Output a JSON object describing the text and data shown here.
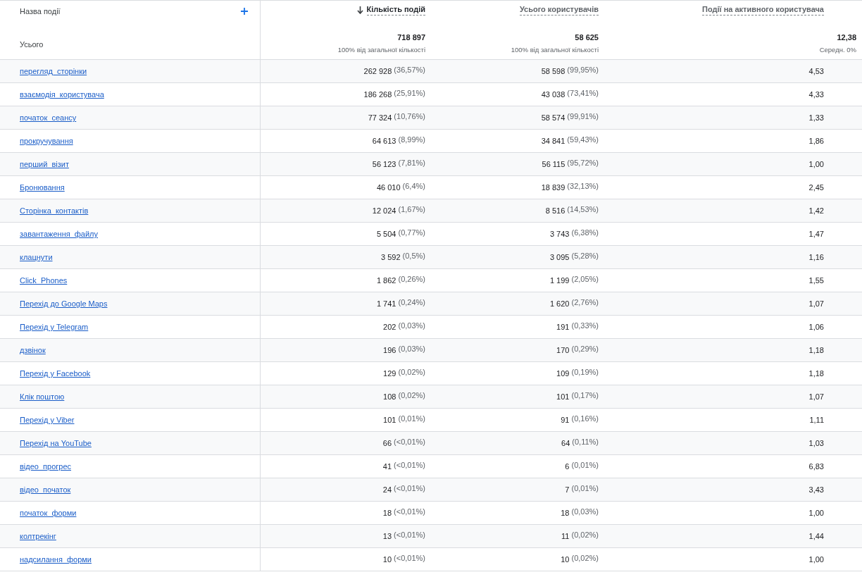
{
  "columns": [
    {
      "label": "Назва події",
      "kind": "dimension"
    },
    {
      "label": "Кількість подій",
      "kind": "metric",
      "sorted": true
    },
    {
      "label": "Усього користувачів",
      "kind": "metric",
      "sorted": false
    },
    {
      "label": "Події на активного користувача",
      "kind": "metric",
      "sorted": false
    }
  ],
  "totals": {
    "label": "Усього",
    "values": [
      {
        "value": "718 897",
        "note": "100% від загальної кількості"
      },
      {
        "value": "58 625",
        "note": "100% від загальної кількості"
      },
      {
        "value": "12,38",
        "note": "Середн. 0%"
      }
    ]
  },
  "rows": [
    {
      "name": "перегляд_сторінки",
      "events": "262 928",
      "events_pct": "(36,57%)",
      "users": "58 598",
      "users_pct": "(99,95%)",
      "per_user": "4,53"
    },
    {
      "name": "взаємодія_користувача",
      "events": "186 268",
      "events_pct": "(25,91%)",
      "users": "43 038",
      "users_pct": "(73,41%)",
      "per_user": "4,33"
    },
    {
      "name": "початок_сеансу",
      "events": "77 324",
      "events_pct": "(10,76%)",
      "users": "58 574",
      "users_pct": "(99,91%)",
      "per_user": "1,33"
    },
    {
      "name": "прокручування",
      "events": "64 613",
      "events_pct": "(8,99%)",
      "users": "34 841",
      "users_pct": "(59,43%)",
      "per_user": "1,86"
    },
    {
      "name": "перший_візит",
      "events": "56 123",
      "events_pct": "(7,81%)",
      "users": "56 115",
      "users_pct": "(95,72%)",
      "per_user": "1,00"
    },
    {
      "name": "Бронювання",
      "events": "46 010",
      "events_pct": "(6,4%)",
      "users": "18 839",
      "users_pct": "(32,13%)",
      "per_user": "2,45"
    },
    {
      "name": "Сторінка_контактів",
      "events": "12 024",
      "events_pct": "(1,67%)",
      "users": "8 516",
      "users_pct": "(14,53%)",
      "per_user": "1,42"
    },
    {
      "name": "завантаження_файлу",
      "events": "5 504",
      "events_pct": "(0,77%)",
      "users": "3 743",
      "users_pct": "(6,38%)",
      "per_user": "1,47"
    },
    {
      "name": "клацнути",
      "events": "3 592",
      "events_pct": "(0,5%)",
      "users": "3 095",
      "users_pct": "(5,28%)",
      "per_user": "1,16"
    },
    {
      "name": "Click_Phones",
      "events": "1 862",
      "events_pct": "(0,26%)",
      "users": "1 199",
      "users_pct": "(2,05%)",
      "per_user": "1,55"
    },
    {
      "name": "Перехід до Google Maps",
      "events": "1 741",
      "events_pct": "(0,24%)",
      "users": "1 620",
      "users_pct": "(2,76%)",
      "per_user": "1,07"
    },
    {
      "name": "Перехід у Telegram",
      "events": "202",
      "events_pct": "(0,03%)",
      "users": "191",
      "users_pct": "(0,33%)",
      "per_user": "1,06"
    },
    {
      "name": "дзвінок",
      "events": "196",
      "events_pct": "(0,03%)",
      "users": "170",
      "users_pct": "(0,29%)",
      "per_user": "1,18"
    },
    {
      "name": "Перехід у Facebook",
      "events": "129",
      "events_pct": "(0,02%)",
      "users": "109",
      "users_pct": "(0,19%)",
      "per_user": "1,18"
    },
    {
      "name": "Клік поштою",
      "events": "108",
      "events_pct": "(0,02%)",
      "users": "101",
      "users_pct": "(0,17%)",
      "per_user": "1,07"
    },
    {
      "name": "Перехід у Viber",
      "events": "101",
      "events_pct": "(0,01%)",
      "users": "91",
      "users_pct": "(0,16%)",
      "per_user": "1,11"
    },
    {
      "name": "Перехід на YouTube",
      "events": "66",
      "events_pct": "(<0,01%)",
      "users": "64",
      "users_pct": "(0,11%)",
      "per_user": "1,03"
    },
    {
      "name": "відео_прогрес",
      "events": "41",
      "events_pct": "(<0,01%)",
      "users": "6",
      "users_pct": "(0,01%)",
      "per_user": "6,83"
    },
    {
      "name": "відео_початок",
      "events": "24",
      "events_pct": "(<0,01%)",
      "users": "7",
      "users_pct": "(0,01%)",
      "per_user": "3,43"
    },
    {
      "name": "початок_форми",
      "events": "18",
      "events_pct": "(<0,01%)",
      "users": "18",
      "users_pct": "(0,03%)",
      "per_user": "1,00"
    },
    {
      "name": "колтрекінг",
      "events": "13",
      "events_pct": "(<0,01%)",
      "users": "11",
      "users_pct": "(0,02%)",
      "per_user": "1,44"
    },
    {
      "name": "надсилання_форми",
      "events": "10",
      "events_pct": "(<0,01%)",
      "users": "10",
      "users_pct": "(0,02%)",
      "per_user": "1,00"
    }
  ]
}
